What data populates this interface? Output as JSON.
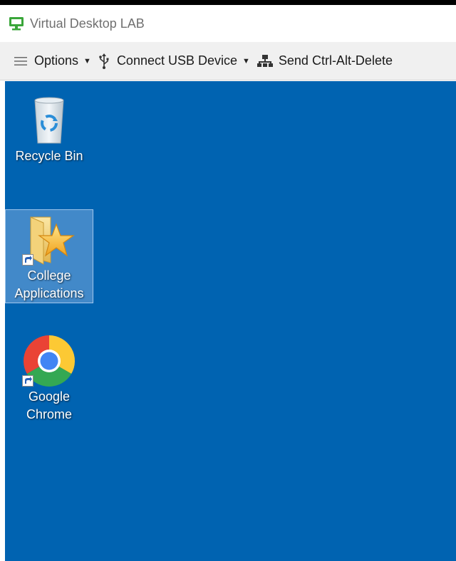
{
  "window": {
    "title": "Virtual Desktop LAB",
    "app_icon": "monitor-icon",
    "accent": "#3aa63a"
  },
  "toolbar": {
    "options_label": "Options",
    "usb_label": "Connect USB Device",
    "cad_label": "Send Ctrl-Alt-Delete",
    "icons": [
      "hamburger-icon",
      "usb-icon",
      "network-icon"
    ]
  },
  "desktop": {
    "background": "#0063b1",
    "icons": [
      {
        "label": "Recycle Bin",
        "icon": "recycle-bin-icon",
        "selected": false
      },
      {
        "label": "College Applications",
        "icon": "folder-star-icon",
        "selected": true,
        "shortcut": true
      },
      {
        "label": "Google Chrome",
        "icon": "chrome-icon",
        "selected": false,
        "shortcut": true
      }
    ]
  }
}
